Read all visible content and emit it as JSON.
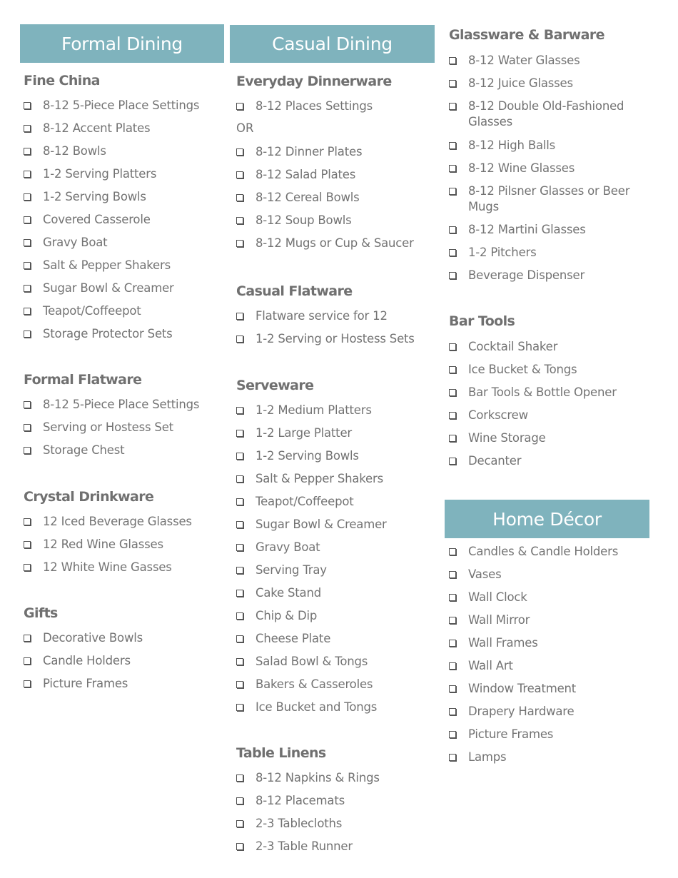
{
  "columns": [
    {
      "header": "Formal Dining",
      "sections": [
        {
          "title": "Fine China",
          "items": [
            "8-12 5-Piece Place Settings",
            "8-12 Accent Plates",
            "8-12 Bowls",
            "1-2 Serving Platters",
            "1-2 Serving Bowls",
            "Covered Casserole",
            "Gravy Boat",
            "Salt & Pepper Shakers",
            "Sugar Bowl & Creamer",
            "Teapot/Coffeepot",
            "Storage Protector Sets"
          ]
        },
        {
          "title": "Formal Flatware",
          "items": [
            "8-12 5-Piece Place Settings",
            "Serving or Hostess Set",
            "Storage Chest"
          ]
        },
        {
          "title": "Crystal Drinkware",
          "items": [
            "12 Iced Beverage Glasses",
            "12 Red Wine Glasses",
            "12 White Wine Gasses"
          ]
        },
        {
          "title": "Gifts",
          "items": [
            "Decorative Bowls",
            "Candle Holders",
            "Picture Frames"
          ]
        }
      ]
    },
    {
      "header": "Casual Dining",
      "sections": [
        {
          "title": "Everyday Dinnerware",
          "items": [
            "8-12 Places Settings"
          ],
          "separator": "OR",
          "items_after": [
            "8-12 Dinner Plates",
            "8-12 Salad Plates",
            "8-12 Cereal Bowls",
            "8-12 Soup Bowls",
            "8-12 Mugs or Cup & Saucer"
          ]
        },
        {
          "title": "Casual Flatware",
          "items": [
            "Flatware service for 12",
            "1-2 Serving or Hostess Sets"
          ]
        },
        {
          "title": "Serveware",
          "items": [
            "1-2 Medium Platters",
            "1-2 Large Platter",
            "1-2 Serving Bowls",
            "Salt & Pepper Shakers",
            "Teapot/Coffeepot",
            "Sugar Bowl & Creamer",
            "Gravy Boat",
            "Serving Tray",
            "Cake Stand",
            "Chip & Dip",
            "Cheese Plate",
            "Salad Bowl & Tongs",
            "Bakers & Casseroles",
            "Ice Bucket and Tongs"
          ]
        },
        {
          "title": "Table Linens",
          "items": [
            "8-12 Napkins & Rings",
            "8-12 Placemats",
            "2-3 Tablecloths",
            "2-3 Table Runner"
          ]
        }
      ]
    },
    {
      "sections": [
        {
          "title": "Glassware & Barware",
          "items": [
            "8-12 Water Glasses",
            "8-12 Juice Glasses",
            "8-12 Double Old-Fashioned Glasses",
            "8-12 High Balls",
            "8-12 Wine Glasses",
            "8-12 Pilsner Glasses or Beer Mugs",
            "8-12 Martini Glasses",
            "1-2 Pitchers",
            "Beverage Dispenser"
          ]
        },
        {
          "title": "Bar Tools",
          "items": [
            "Cocktail Shaker",
            "Ice Bucket & Tongs",
            "Bar Tools & Bottle Opener",
            "Corkscrew",
            "Wine Storage",
            "Decanter"
          ]
        }
      ],
      "header2": "Home Décor",
      "sections2": [
        {
          "items": [
            "Candles & Candle Holders",
            "Vases",
            "Wall Clock",
            "Wall Mirror",
            "Wall Frames",
            "Wall Art",
            "Window Treatment",
            "Drapery Hardware",
            "Picture Frames",
            "Lamps"
          ]
        }
      ]
    }
  ],
  "colors": {
    "header_bg": "#7fb3bd",
    "header_text": "#ffffff",
    "text": "#737373"
  }
}
